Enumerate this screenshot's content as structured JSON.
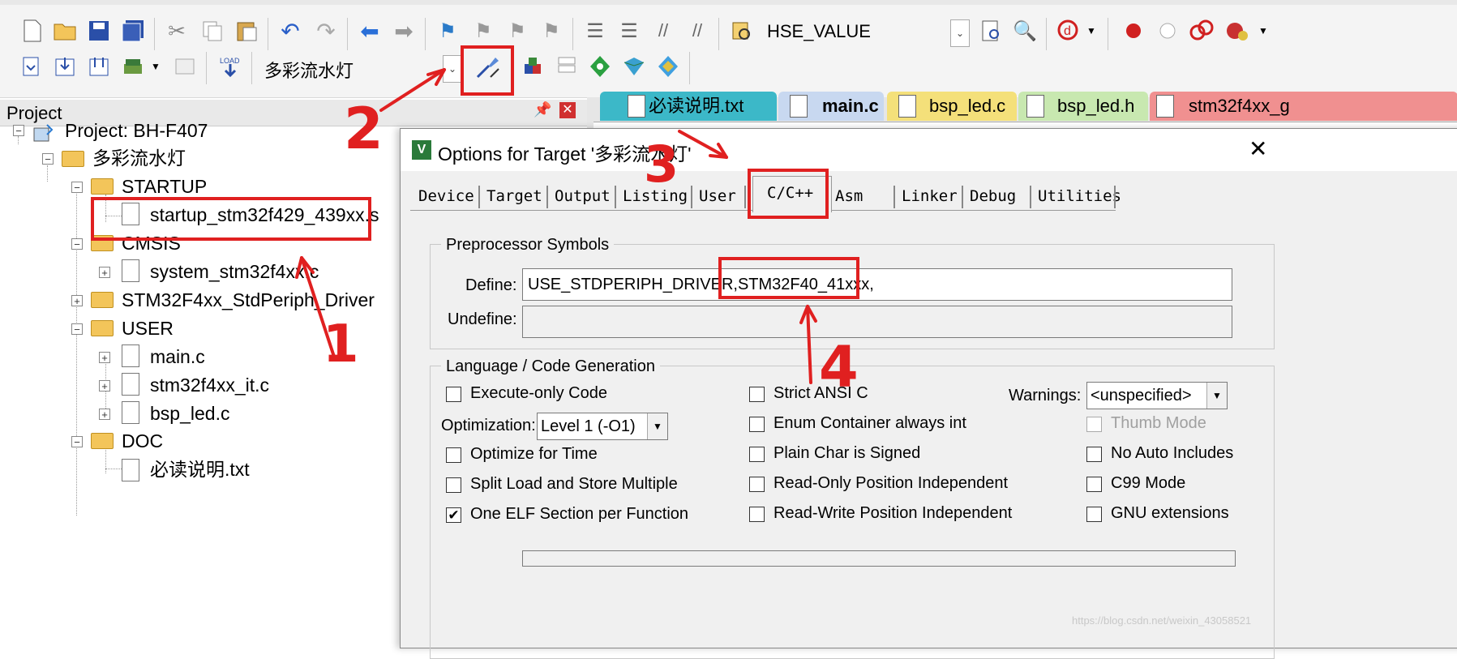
{
  "toolbar1": {
    "define_combo": "HSE_VALUE"
  },
  "toolbar2": {
    "target_combo": "多彩流水灯"
  },
  "project_panel": {
    "title": "Project",
    "pin_icon": "pin-icon",
    "close_icon": "close-icon",
    "tree": [
      {
        "label": "Project: BH-F407"
      },
      {
        "label": "多彩流水灯"
      },
      {
        "label": "STARTUP"
      },
      {
        "label": "startup_stm32f429_439xx.s"
      },
      {
        "label": "CMSIS"
      },
      {
        "label": "system_stm32f4xx.c"
      },
      {
        "label": "STM32F4xx_StdPeriph_Driver"
      },
      {
        "label": "USER"
      },
      {
        "label": "main.c"
      },
      {
        "label": "stm32f4xx_it.c"
      },
      {
        "label": "bsp_led.c"
      },
      {
        "label": "DOC"
      },
      {
        "label": "必读说明.txt"
      }
    ]
  },
  "editor_tabs": [
    {
      "label": "必读说明.txt",
      "color": "#3cb8c8"
    },
    {
      "label": "main.c",
      "color": "#c8d8f0"
    },
    {
      "label": "bsp_led.c",
      "color": "#f4e07a"
    },
    {
      "label": "bsp_led.h",
      "color": "#c8e8b0"
    },
    {
      "label": "stm32f4xx_g",
      "color": "#f09090"
    }
  ],
  "dialog": {
    "title": "Options for Target '多彩流水灯'",
    "tabs": [
      "Device",
      "Target",
      "Output",
      "Listing",
      "User",
      "C/C++",
      "Asm",
      "Linker",
      "Debug",
      "Utilities"
    ],
    "preprocessor": {
      "group_label": "Preprocessor Symbols",
      "define_label": "Define:",
      "define_value_part1": "USE_STDPERIPH_DRIVER,",
      "define_value_part2": "STM32F40_41xxx,",
      "undefine_label": "Undefine:"
    },
    "language": {
      "group_label": "Language / Code Generation",
      "execute_only": "Execute-only Code",
      "optimization_label": "Optimization:",
      "optimization_value": "Level 1 (-O1)",
      "optimize_time": "Optimize for Time",
      "split_load": "Split Load and Store Multiple",
      "one_elf": "One ELF Section per Function",
      "strict_ansi": "Strict ANSI C",
      "enum_container": "Enum Container always int",
      "plain_char": "Plain Char is Signed",
      "ro_pi": "Read-Only Position Independent",
      "rw_pi": "Read-Write Position Independent",
      "warnings_label": "Warnings:",
      "warnings_value": "<unspecified>",
      "thumb_mode": "Thumb Mode",
      "no_auto_includes": "No Auto Includes",
      "c99_mode": "C99 Mode",
      "gnu_ext": "GNU extensions"
    }
  },
  "annotations": [
    "1",
    "2",
    "3",
    "4"
  ],
  "watermark": "https://blog.csdn.net/weixin_43058521"
}
